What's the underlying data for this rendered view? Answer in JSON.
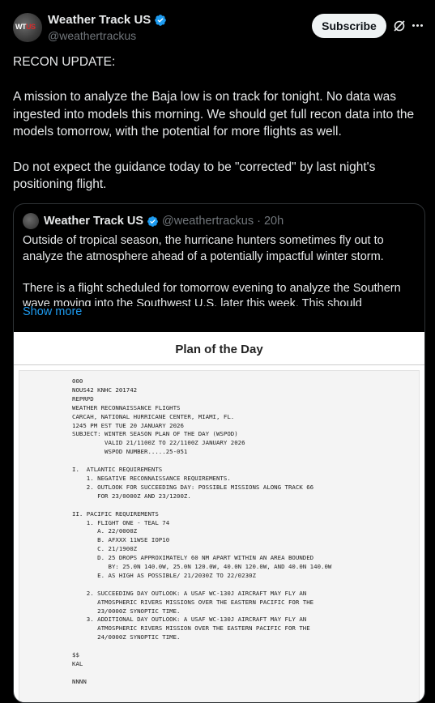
{
  "author": {
    "name": "Weather Track US",
    "handle": "@weathertrackus",
    "avatar_text_wt": "WT",
    "avatar_text_us": "US"
  },
  "actions": {
    "subscribe_label": "Subscribe",
    "grok_icon": "grok-slash-icon",
    "more_icon": "more-horizontal-icon"
  },
  "post": {
    "text": "RECON UPDATE:\n\nA mission to analyze the Baja low is on track for tonight. No data was ingested into models this morning. We should get full recon data into the models tomorrow, with the potential for more flights as well.\n\nDo not expect the guidance today to be \"corrected\" by last night's positioning flight."
  },
  "quote": {
    "name": "Weather Track US",
    "handle": "@weathertrackus",
    "separator": "·",
    "time": "20h",
    "text": "Outside of tropical season, the hurricane hunters sometimes fly out to analyze the atmosphere ahead of a potentially impactful winter storm.\n\nThere is a flight scheduled for tomorrow evening to analyze the Southern wave moving into the Southwest U.S. later this week. This should",
    "show_more": "Show more",
    "document": {
      "title": "Plan of the Day",
      "body": "000\nNOUS42 KNHC 201742\nREPRPD\nWEATHER RECONNAISSANCE FLIGHTS\nCARCAH, NATIONAL HURRICANE CENTER, MIAMI, FL.\n1245 PM EST TUE 20 JANUARY 2026\nSUBJECT: WINTER SEASON PLAN OF THE DAY (WSPOD)\n         VALID 21/1100Z TO 22/1100Z JANUARY 2026\n         WSPOD NUMBER.....25-051\n\nI.  ATLANTIC REQUIREMENTS\n    1. NEGATIVE RECONNAISSANCE REQUIREMENTS.\n    2. OUTLOOK FOR SUCCEEDING DAY: POSSIBLE MISSIONS ALONG TRACK 66\n       FOR 23/0000Z AND 23/1200Z.\n\nII. PACIFIC REQUIREMENTS\n    1. FLIGHT ONE - TEAL 74\n       A. 22/0000Z\n       B. AFXXX 11WSE IOP10\n       C. 21/1900Z\n       D. 25 DROPS APPROXIMATELY 60 NM APART WITHIN AN AREA BOUNDED\n          BY: 25.0N 140.0W, 25.0N 120.0W, 40.0N 120.0W, AND 40.0N 140.0W\n       E. AS HIGH AS POSSIBLE/ 21/2030Z TO 22/0230Z\n\n    2. SUCCEEDING DAY OUTLOOK: A USAF WC-130J AIRCRAFT MAY FLY AN\n       ATMOSPHERIC RIVERS MISSIONS OVER THE EASTERN PACIFIC FOR THE\n       23/0000Z SYNOPTIC TIME.\n    3. ADDITIONAL DAY OUTLOOK: A USAF WC-130J AIRCRAFT MAY FLY AN\n       ATMOSPHERIC RIVERS MISSION OVER THE EASTERN PACIFIC FOR THE\n       24/0000Z SYNOPTIC TIME.\n\n$$\nKAL\n\nNNNN"
    }
  },
  "colors": {
    "background": "#000000",
    "text": "#e7e9ea",
    "muted": "#71767b",
    "link": "#1d9bf0",
    "verified": "#1d9bf0",
    "border": "#2f3336",
    "subscribe_bg": "#eff3f4"
  }
}
